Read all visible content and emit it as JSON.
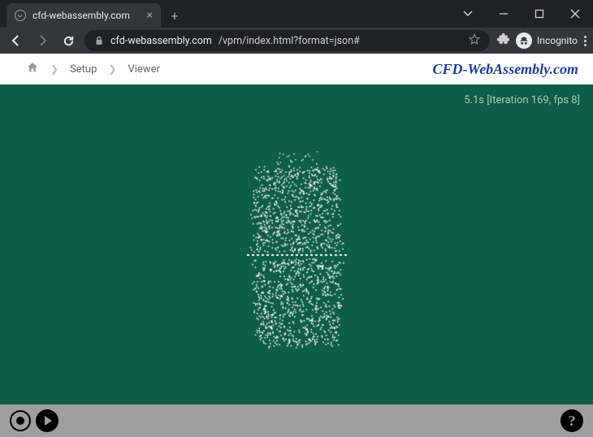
{
  "browser": {
    "tab_title": "cfd-webassembly.com",
    "url_host": "cfd-webassembly.com",
    "url_path": "/vpm/index.html?format=json#",
    "incognito_label": "Incognito"
  },
  "breadcrumbs": {
    "item1": "Setup",
    "item2": "Viewer"
  },
  "brand": "CFD-WebAssembly.com",
  "status": {
    "elapsed_s": 5.1,
    "iteration": 169,
    "fps": 8,
    "text": "5.1s [Iteration 169, fps 8]"
  },
  "colors": {
    "viewport_bg": "#0e5d45",
    "brand_text": "#203a9f",
    "footer_bg": "#9e9e9e"
  },
  "help_label": "?"
}
